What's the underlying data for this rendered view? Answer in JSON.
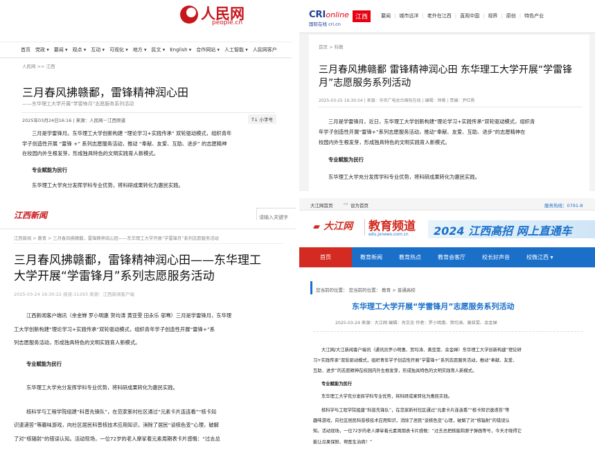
{
  "p1": {
    "logo_cn": "人民网",
    "logo_en": "people.cn",
    "nav": [
      "首页",
      "党政 ▾",
      "要闻 ▾",
      "观点 ▾",
      "互动 ▾",
      "可视化 ▾",
      "地方 ▾",
      "民文 ▾",
      "English ▾",
      "合作网站 ▾",
      "人工智能 ▾",
      "人民网客户"
    ],
    "breadcrumb": "人民网 >> 江西",
    "title": "三月春风拂赣鄱，雷锋精神润心田",
    "subtitle": "——东华理工大学开展“学雷锋月”志愿服务系列活动",
    "meta": "2025年03月24日16:16 | 来源：人民网－江西频道",
    "font_btn": "T↓ 小字号",
    "para1_l1": "三月是学雷锋月。东华理工大学创新构建 “理论学习+实践传承” 双轮驱动模式，组织青年",
    "para1_l2": "学子创造性开展 “雷锋 +” 系列志愿服务活动，推动 “奉献、友爱、互助、进步” 的志愿精神",
    "para1_l3": "在校园内外生根发芽，形成独具特色的文明实践育人新模式。",
    "heading": "专业赋能为民行",
    "para2": "东华理工大学充分发挥学科专业优势，将科研成果转化为惠民实践。"
  },
  "p2": {
    "logo": "CRI",
    "logo_sub": "国际在线 cri.cn",
    "region": "江西",
    "nav": [
      "要闻",
      "城市远洋",
      "老外在江西",
      "直观中国",
      "视界",
      "原创",
      "特色产业"
    ],
    "breadcrumb": "首页 > 科教",
    "title_l1": "三月春风拂赣鄱 雷锋精神润心田 东华理工大学开展“学雷锋",
    "title_l2": "月”志愿服务系列活动",
    "meta": "2025-03-25 16:30:54 | 来源：中央广电总台国际在线 | 编辑：钟薇 | 责编：尹红燕",
    "para1_l1": "三月是学雷锋月，近日，东华理工大学创新构建“理论学习+实践传承”双轮驱动模式，组织青",
    "para1_l2": "年学子创造性开展“雷锋+”系列志愿服务活动，推动“奉献、友爱、互助、进步”的志愿精神在",
    "para1_l3": "校园内外生根发芽，形成独具特色的文明实践育人新模式。",
    "heading": "专业赋能为民行",
    "para2": "东华理工大学充分发挥学科专业优势，将科研成果转化为惠民实践。"
  },
  "p3": {
    "logo": "江西新闻",
    "search_placeholder": "请输入关键字",
    "breadcrumb": "江西新闻 > 教育 > 三月春风拂赣鄱，雷锋精神润心田——东华理工大学开展“学雷锋月”系列志愿服务活动",
    "title_l1": "三月春风拂赣鄱，雷锋精神润心田——东华理工",
    "title_l2": "大学开展“学雷锋月”系列志愿服务活动",
    "meta": "2025-03-24 16:30:22   阅读:11293   来源：江西新闻客户端",
    "para1_l1": "江西新闻客户端讯（余金婵 罗小明惠 贺均涛 黄亚雯 田永乐 邬骞）三月是学雷锋月，东华理",
    "para1_l2": "工大学创新构建“理论学习+实践传承”双轮驱动模式，组织青年学子创造性开展“雷锋+”系",
    "para1_l3": "列志愿服务活动，形成独具特色的文明实践育人新模式。",
    "heading": "专业赋能为民行",
    "para2": "东华理工大学充分发挥学科专业优势，将科研成果转化为惠民实践。",
    "para3_l1": "核科学与工程学院组建“科普先锋队”，在范家新村社区通过“元素卡片连连看”“核卡知",
    "para3_l2": "识速递答”等趣味游戏，向社区居民科普核技术应用知识，消除了居民“谈核色变”心理，破解",
    "para3_l3": "了对“核辐射”的错误认知。活动现场，一位72岁的老人摩挲着元素周期表卡片感慨：“过去总"
  },
  "p4": {
    "top_links": [
      "大江网首页",
      "设为首页"
    ],
    "hotline": "服务热线：0791-8",
    "logo": "大江网",
    "channel": "教育频道",
    "channel_url": "edu.jxnews.com.cn",
    "banner": "2024 江西高招 网上直通车",
    "nav": [
      "首页",
      "教育新闻",
      "教育热点",
      "教育会客厅",
      "校长好声音",
      "校微江西 ▾"
    ],
    "breadcrumb": "您当前的位置：  您当前的位置：  教育 > 普通高校",
    "title": "东华理工大学开展“学雷锋月”志愿服务系列活动",
    "meta": "2025-03-24      来源：大江网      编辑：肖文忠      作者：罗小明惠、贺均涛、黄亚雯、余金婵",
    "para1_l1": "大江网/大江新闻客户端讯（通讯员罗小明惠、贺均涛、黄亚雯、余金婵）东华理工大学创新构建“理论研",
    "para1_l2": "习+实践传承”双轮驱动模式，组织青年学子创造性开展“学雷锋+”系列志愿服务活动，推动“奉献、友爱、",
    "para1_l3": "互助、进步”的志愿精神在校园内外生根发芽，形成独具特色的文明实践育人新模式。",
    "heading": "专业赋能为民行",
    "para2": "东华理工大学充分发挥学科专业优势，将科研成果转化为惠民实践。",
    "para3_l1": "核科学与工程学院组建“科普先锋队”，在范家新村社区通过“元素卡片连连看”“核卡知识速递答”等",
    "para3_l2": "趣味游戏，向社区居民科普核技术应用知识，消除了居民“谈核色变”心理，破解了对“核辐射”的错误认",
    "para3_l3": "知。活动现场，一位72岁的老人摩挲着元素周期表卡片感慨：“过去总把核能和原子弹画等号，今天才晓得它",
    "para3_l4": "能让瓜果保鲜、帮医生治病！”"
  },
  "colors": {
    "people_red": "#c8161d",
    "cri_red": "#e60012",
    "jx_blue": "#1a6fc9",
    "dj_red": "#d32b21"
  }
}
